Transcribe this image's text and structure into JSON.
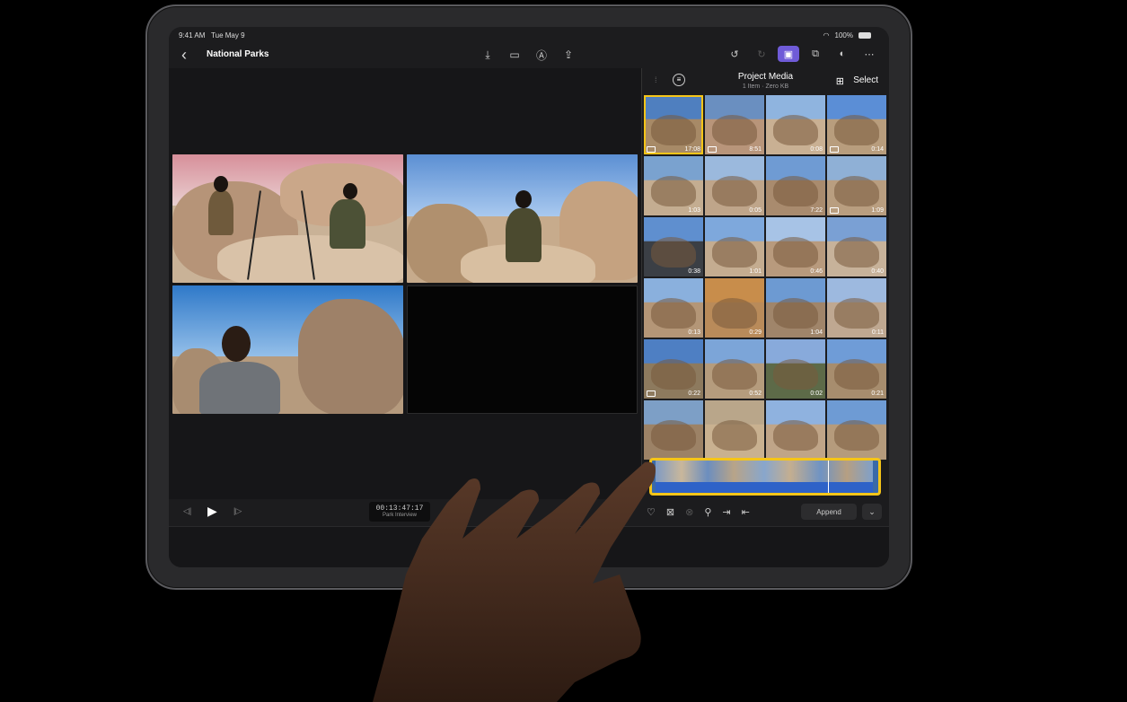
{
  "status": {
    "time": "9:41 AM",
    "date": "Tue May 9",
    "battery": "100%"
  },
  "nav": {
    "title": "National Parks"
  },
  "media": {
    "title": "Project Media",
    "subtitle": "1 Item  ·  Zero KB",
    "select_label": "Select",
    "durations": [
      "17:08",
      "8:51",
      "0:08",
      "0:14",
      "1:03",
      "0:05",
      "7:22",
      "1:09",
      "0:38",
      "1:01",
      "0:46",
      "0:40",
      "0:13",
      "0:29",
      "1:04",
      "0:11",
      "0:22",
      "0:52",
      "0:02",
      "0:21",
      "",
      "",
      "",
      ""
    ]
  },
  "player": {
    "timecode": "00:13:47:17",
    "clip_name": "Park Interview"
  },
  "tools": {
    "append_label": "Append"
  },
  "colors": {
    "accent_yellow": "#f5c518",
    "accent_purple": "#6f5bd8"
  }
}
